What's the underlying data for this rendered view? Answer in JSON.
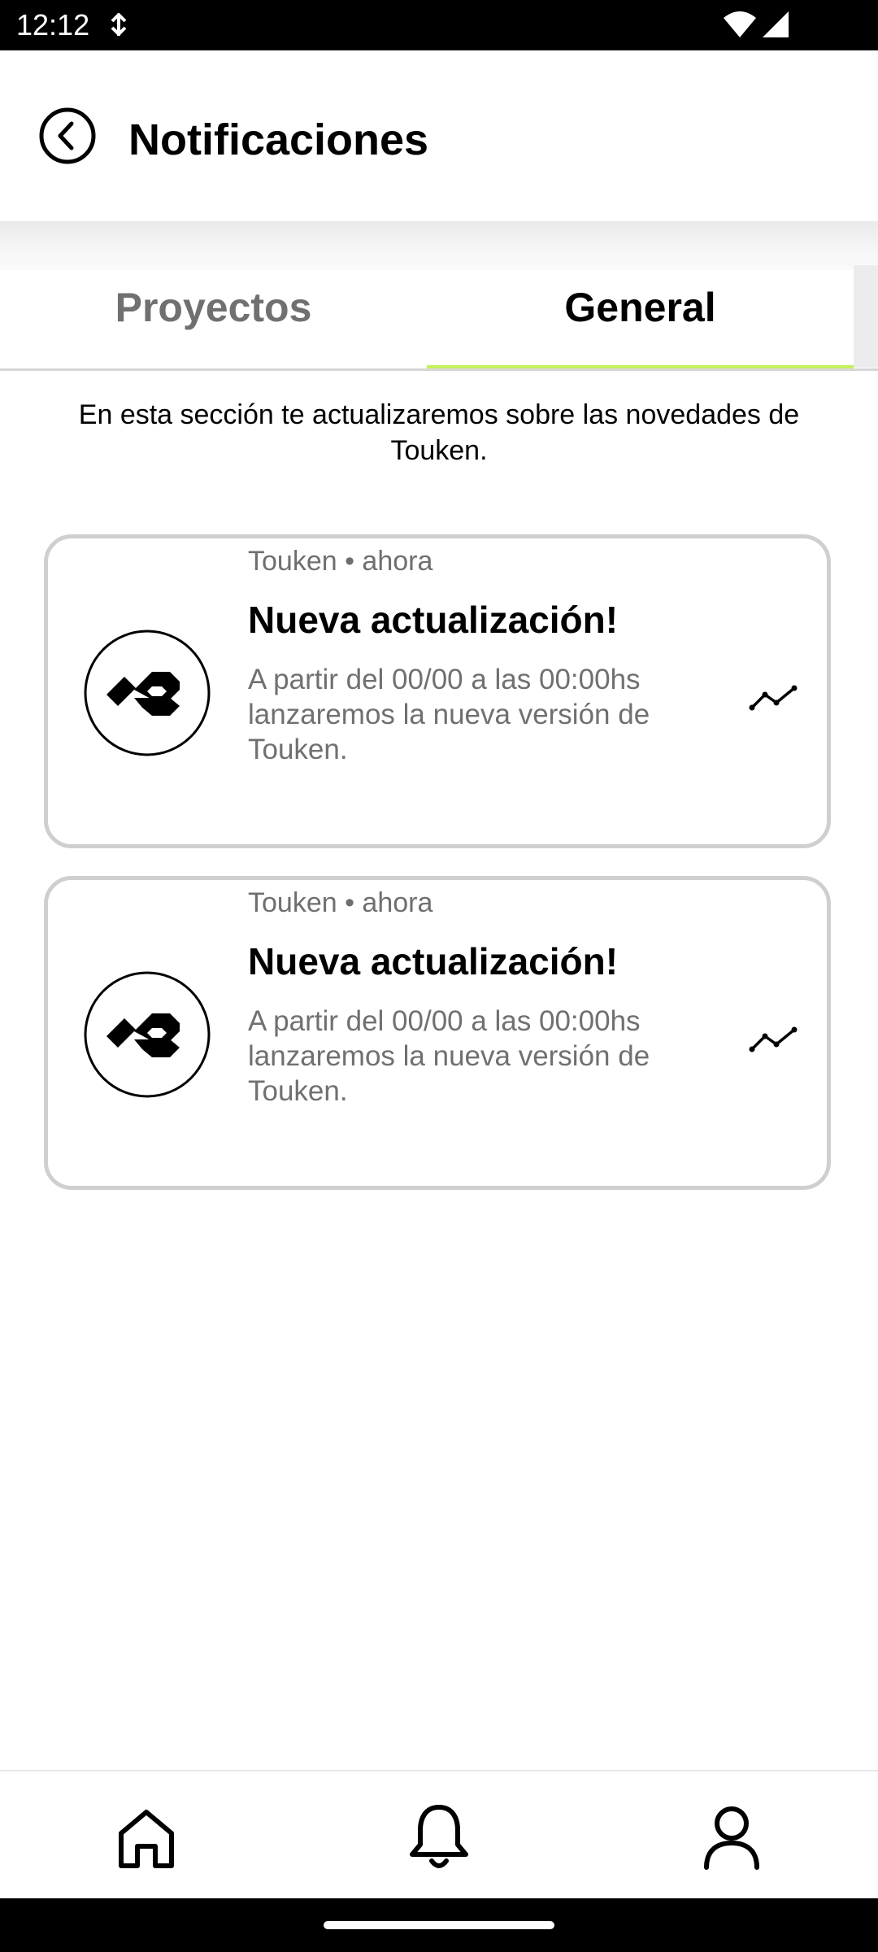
{
  "status_bar": {
    "time": "12:12",
    "icons": [
      "usb-debug-icon",
      "wifi-icon",
      "cellular-signal-icon"
    ]
  },
  "app_bar": {
    "back_icon": "back-arrow-circle-icon",
    "title": "Notificaciones"
  },
  "tabs": [
    {
      "label": "Proyectos",
      "active": false
    },
    {
      "label": "General",
      "active": true
    }
  ],
  "accent_color": "#c4f15c",
  "intro_text": "En esta sección te actualizaremos sobre las novedades de Touken.",
  "notifications": [
    {
      "source": "Touken • ahora",
      "title": "Nueva actualización!",
      "body": "A partir del 00/00 a las 00:00hs lanzaremos la nueva versión de Touken.",
      "icon": "touken-logo-icon",
      "action_icon": "trend-line-icon"
    },
    {
      "source": "Touken • ahora",
      "title": "Nueva actualización!",
      "body": "A partir del 00/00 a las 00:00hs lanzaremos la nueva versión de Touken.",
      "icon": "touken-logo-icon",
      "action_icon": "trend-line-icon"
    }
  ],
  "bottom_nav": [
    {
      "icon": "home-icon"
    },
    {
      "icon": "bell-icon"
    },
    {
      "icon": "user-icon"
    }
  ]
}
